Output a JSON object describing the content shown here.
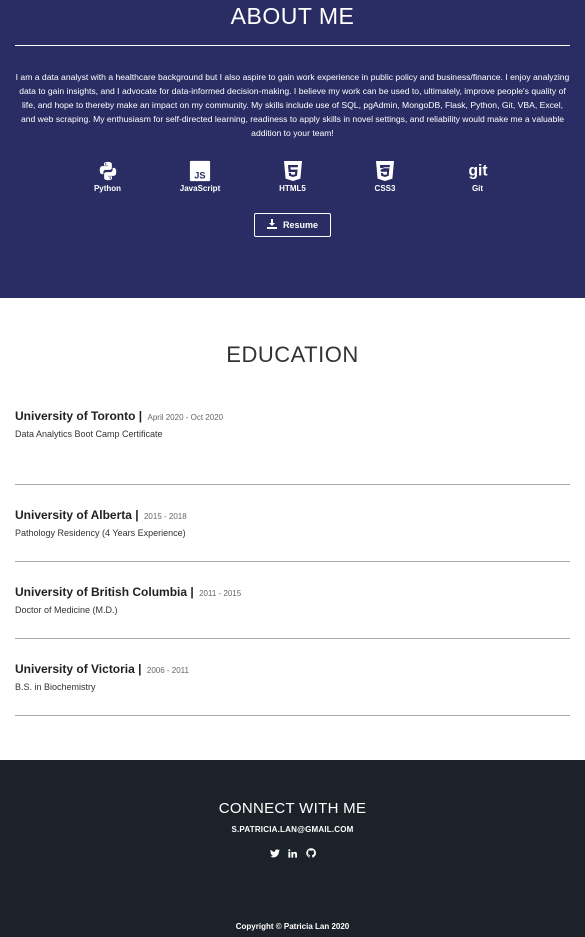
{
  "about": {
    "title": "ABOUT ME",
    "text": "I am a data analyst with a healthcare background but I also aspire to gain work experience in public policy and business/finance. I enjoy analyzing data to gain insights, and I advocate for data-informed decision-making. I believe my work can be used to, ultimately, improve people's quality of life, and hope to thereby make an impact on my community. My skills include use of SQL, pgAdmin, MongoDB, Flask, Python, Git, VBA, Excel, and web scraping. My enthusiasm for self-directed learning, readiness to apply skills in novel settings, and reliability would make me a valuable addition to your team!",
    "skills": [
      {
        "label": "Python",
        "icon": "python-icon"
      },
      {
        "label": "JavaScript",
        "icon": "javascript-icon"
      },
      {
        "label": "HTML5",
        "icon": "html5-icon"
      },
      {
        "label": "CSS3",
        "icon": "css3-icon"
      },
      {
        "label": "Git",
        "icon": "git-icon"
      }
    ],
    "resume_label": "Resume"
  },
  "education": {
    "title": "EDUCATION",
    "items": [
      {
        "school": "University of Toronto",
        "sep": "|",
        "dates": "April 2020 - Oct 2020",
        "detail": "Data Analytics Boot Camp Certificate"
      },
      {
        "school": "University of Alberta",
        "sep": "|",
        "dates": "2015 - 2018",
        "detail": "Pathology Residency (4 Years Experience)"
      },
      {
        "school": "University of British Columbia",
        "sep": "|",
        "dates": "2011 - 2015",
        "detail": "Doctor of Medicine (M.D.)"
      },
      {
        "school": "University of Victoria",
        "sep": "|",
        "dates": "2006 - 2011",
        "detail": "B.S. in Biochemistry"
      }
    ]
  },
  "footer": {
    "title": "CONNECT WITH ME",
    "email": "S.PATRICIA.LAN@GMAIL.COM",
    "socials": [
      "twitter-icon",
      "linkedin-icon",
      "github-icon"
    ],
    "copyright": "Copyright © Patricia Lan 2020"
  },
  "colors": {
    "about_bg": "#2a2d63",
    "footer_bg": "#1b2229",
    "text_light": "#ffffff"
  }
}
